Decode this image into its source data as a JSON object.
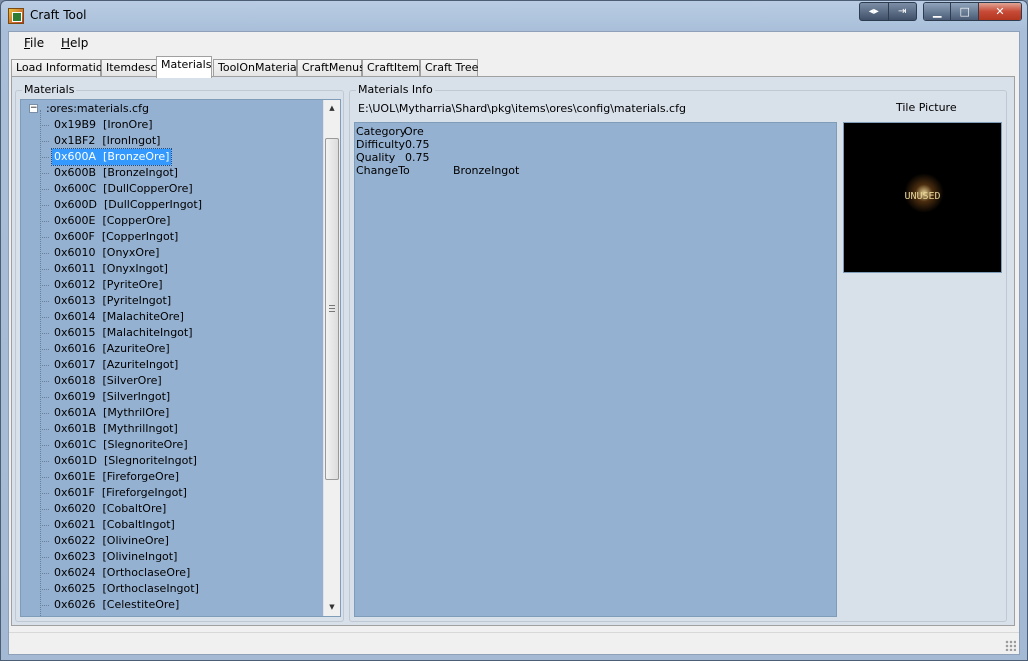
{
  "window": {
    "title": "Craft Tool"
  },
  "menu": {
    "file": "File",
    "help": "Help"
  },
  "tabs": [
    {
      "label": "Load Information",
      "active": false
    },
    {
      "label": "Itemdesc",
      "active": false
    },
    {
      "label": "Materials",
      "active": true
    },
    {
      "label": "ToolOnMaterial",
      "active": false
    },
    {
      "label": "CraftMenus",
      "active": false
    },
    {
      "label": "CraftItems",
      "active": false
    },
    {
      "label": "Craft Tree",
      "active": false
    }
  ],
  "materials_panel": {
    "group_label": "Materials",
    "root_label": ":ores:materials.cfg",
    "expander": "−",
    "items": [
      {
        "label": "0x19B9  [IronOre]",
        "selected": false
      },
      {
        "label": "0x1BF2  [IronIngot]",
        "selected": false
      },
      {
        "label": "0x600A  [BronzeOre]",
        "selected": true
      },
      {
        "label": "0x600B  [BronzeIngot]",
        "selected": false
      },
      {
        "label": "0x600C  [DullCopperOre]",
        "selected": false
      },
      {
        "label": "0x600D  [DullCopperIngot]",
        "selected": false
      },
      {
        "label": "0x600E  [CopperOre]",
        "selected": false
      },
      {
        "label": "0x600F  [CopperIngot]",
        "selected": false
      },
      {
        "label": "0x6010  [OnyxOre]",
        "selected": false
      },
      {
        "label": "0x6011  [OnyxIngot]",
        "selected": false
      },
      {
        "label": "0x6012  [PyriteOre]",
        "selected": false
      },
      {
        "label": "0x6013  [PyriteIngot]",
        "selected": false
      },
      {
        "label": "0x6014  [MalachiteOre]",
        "selected": false
      },
      {
        "label": "0x6015  [MalachiteIngot]",
        "selected": false
      },
      {
        "label": "0x6016  [AzuriteOre]",
        "selected": false
      },
      {
        "label": "0x6017  [AzuriteIngot]",
        "selected": false
      },
      {
        "label": "0x6018  [SilverOre]",
        "selected": false
      },
      {
        "label": "0x6019  [SilverIngot]",
        "selected": false
      },
      {
        "label": "0x601A  [MythrilOre]",
        "selected": false
      },
      {
        "label": "0x601B  [MythrilIngot]",
        "selected": false
      },
      {
        "label": "0x601C  [SlegnoriteOre]",
        "selected": false
      },
      {
        "label": "0x601D  [SlegnoriteIngot]",
        "selected": false
      },
      {
        "label": "0x601E  [FireforgeOre]",
        "selected": false
      },
      {
        "label": "0x601F  [FireforgeIngot]",
        "selected": false
      },
      {
        "label": "0x6020  [CobaltOre]",
        "selected": false
      },
      {
        "label": "0x6021  [CobaltIngot]",
        "selected": false
      },
      {
        "label": "0x6022  [OlivineOre]",
        "selected": false
      },
      {
        "label": "0x6023  [OlivineIngot]",
        "selected": false
      },
      {
        "label": "0x6024  [OrthoclaseOre]",
        "selected": false
      },
      {
        "label": "0x6025  [OrthoclaseIngot]",
        "selected": false
      },
      {
        "label": "0x6026  [CelestiteOre]",
        "selected": false
      }
    ]
  },
  "info_panel": {
    "group_label": "Materials Info",
    "path": "E:\\UOL\\Mytharria\\Shard\\pkg\\items\\ores\\config\\materials.cfg",
    "rows": [
      {
        "key": "Category",
        "value": "Ore"
      },
      {
        "key": "Difficulty",
        "value": "0.75"
      },
      {
        "key": "Quality",
        "value": "0.75"
      },
      {
        "key": "ChangeTo",
        "value": "BronzeIngot"
      }
    ],
    "tile_label": "Tile Picture",
    "tile_text": "UNUSED"
  }
}
